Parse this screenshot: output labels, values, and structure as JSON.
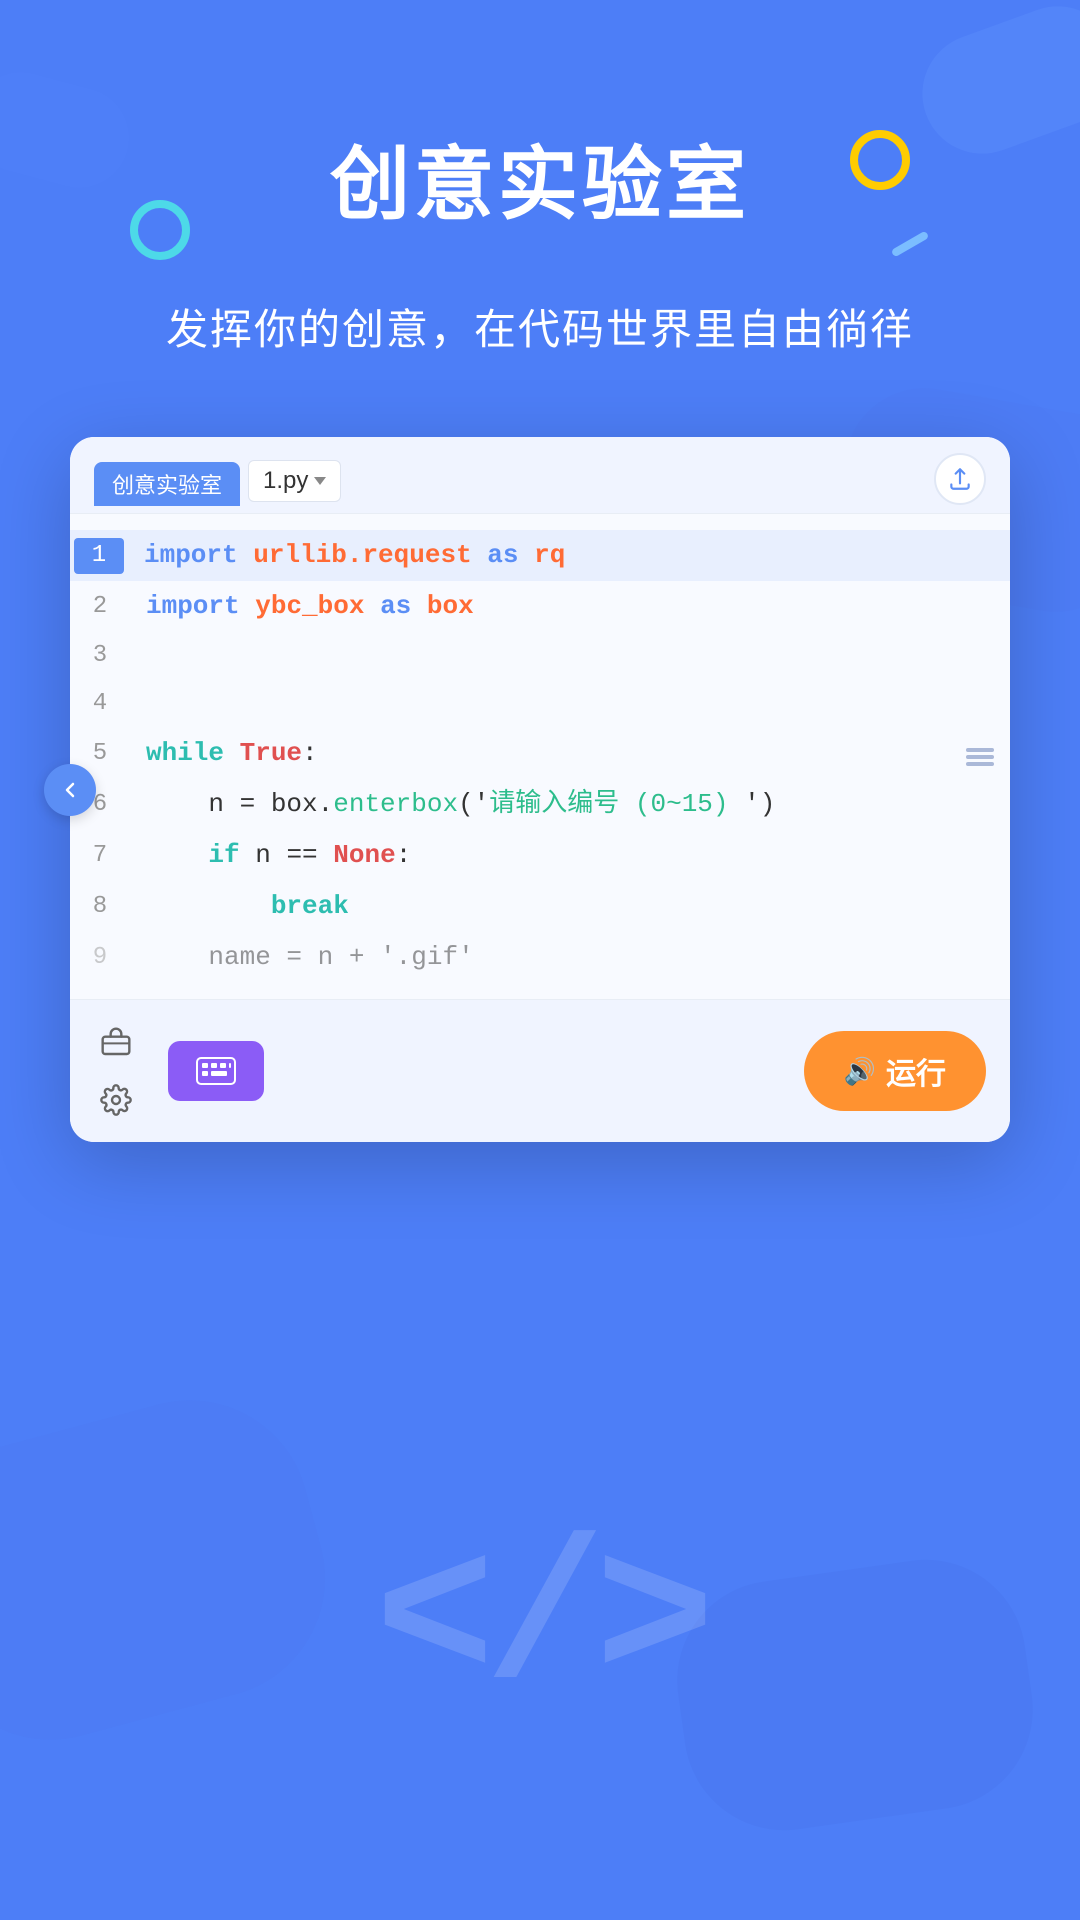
{
  "page": {
    "title": "创意实验室",
    "subtitle": "发挥你的创意，在代码世界里自由徜徉",
    "bg_color": "#4D7EF7"
  },
  "tab": {
    "label": "创意实验室"
  },
  "file": {
    "name": "1.py"
  },
  "code": {
    "lines": [
      {
        "num": "1",
        "active": true,
        "content_html": "<span class='kw-blue'>import</span> <span class='kw-orange'>urllib.request</span> <span class='kw-blue'>as</span> <span class='kw-orange'>rq</span>"
      },
      {
        "num": "2",
        "active": false,
        "content_html": "<span class='kw-blue'>import</span> <span class='kw-orange'>ybc_box</span> <span class='kw-blue'>as</span> <span class='kw-orange'>box</span>"
      },
      {
        "num": "3",
        "active": false,
        "content_html": ""
      },
      {
        "num": "4",
        "active": false,
        "content_html": ""
      },
      {
        "num": "5",
        "active": false,
        "content_html": "<span class='kw-teal'>while</span> <span class='kw-red'>True</span><span class='kw-dark'>:</span>"
      },
      {
        "num": "6",
        "active": false,
        "content_html": "&nbsp;&nbsp;&nbsp;&nbsp;<span class='kw-dark'>n = box.</span><span class='kw-green'>enterbox</span><span class='kw-dark'>('</span><span class='str-green'>请输入编号 (0~15) </span><span class='kw-dark'>')</span>"
      },
      {
        "num": "7",
        "active": false,
        "content_html": "&nbsp;&nbsp;&nbsp;&nbsp;<span class='kw-teal'>if</span> <span class='kw-dark'>n == </span><span class='kw-red'>None</span><span class='kw-dark'>:</span>"
      },
      {
        "num": "8",
        "active": false,
        "content_html": "&nbsp;&nbsp;&nbsp;&nbsp;&nbsp;&nbsp;&nbsp;&nbsp;<span class='kw-teal'>break</span>"
      },
      {
        "num": "9",
        "active": false,
        "content_html": "&nbsp;&nbsp;&nbsp;&nbsp;<span class='kw-dark'>name = n + '.gif'</span>"
      }
    ]
  },
  "buttons": {
    "back_label": "‹",
    "share_label": "↑",
    "keyboard_label": "⌨",
    "run_label": "运行",
    "run_icon": "🔊"
  },
  "bottom": {
    "code_icon": "</>"
  }
}
